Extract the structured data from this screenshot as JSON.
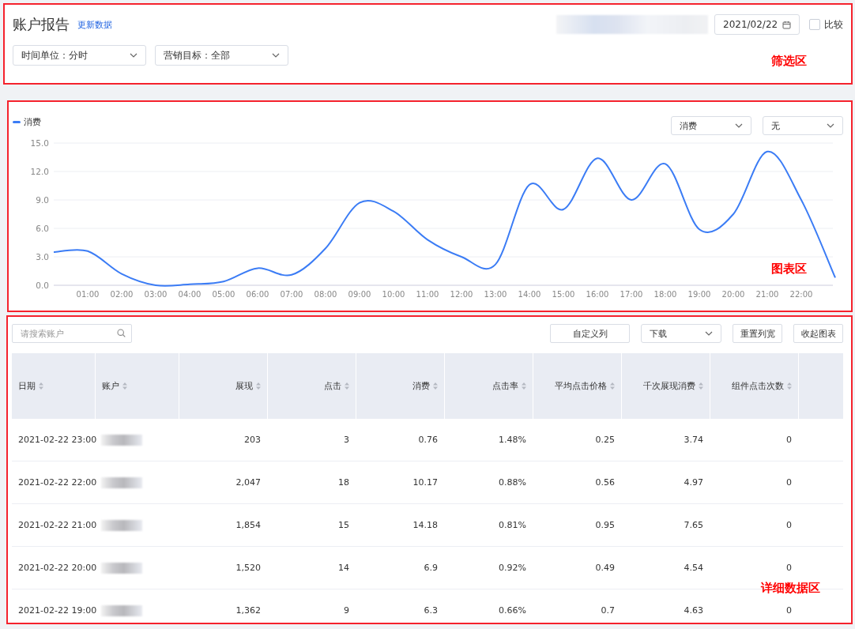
{
  "header": {
    "title": "账户报告",
    "refresh_link": "更新数据",
    "filters": [
      {
        "label": "时间单位：分时"
      },
      {
        "label": "营销目标：全部"
      }
    ],
    "date": "2021/02/22",
    "compare": {
      "label": "比较",
      "checked": false
    },
    "annotation": "筛选区"
  },
  "chart_panel": {
    "selects": [
      "消费",
      "无"
    ],
    "annotation": "图表区",
    "chart_data": {
      "type": "line",
      "grid": true,
      "x": [
        0,
        1,
        2,
        3,
        4,
        5,
        6,
        7,
        8,
        9,
        10,
        11,
        12,
        13,
        14,
        15,
        16,
        17,
        18,
        19,
        20,
        21,
        22,
        23
      ],
      "xlim": [
        0,
        23
      ],
      "xticks": [
        {
          "value": 1,
          "label": "01:00"
        },
        {
          "value": 2,
          "label": "02:00"
        },
        {
          "value": 3,
          "label": "03:00"
        },
        {
          "value": 4,
          "label": "04:00"
        },
        {
          "value": 5,
          "label": "05:00"
        },
        {
          "value": 6,
          "label": "06:00"
        },
        {
          "value": 7,
          "label": "07:00"
        },
        {
          "value": 8,
          "label": "08:00"
        },
        {
          "value": 9,
          "label": "09:00"
        },
        {
          "value": 10,
          "label": "10:00"
        },
        {
          "value": 11,
          "label": "11:00"
        },
        {
          "value": 12,
          "label": "12:00"
        },
        {
          "value": 13,
          "label": "13:00"
        },
        {
          "value": 14,
          "label": "14:00"
        },
        {
          "value": 15,
          "label": "15:00"
        },
        {
          "value": 16,
          "label": "16:00"
        },
        {
          "value": 17,
          "label": "17:00"
        },
        {
          "value": 18,
          "label": "18:00"
        },
        {
          "value": 19,
          "label": "19:00"
        },
        {
          "value": 20,
          "label": "20:00"
        },
        {
          "value": 21,
          "label": "21:00"
        },
        {
          "value": 22,
          "label": "22:00"
        }
      ],
      "ylim": [
        0,
        15
      ],
      "yticks": [
        {
          "value": 0,
          "label": "0.0"
        },
        {
          "value": 3,
          "label": "3.0"
        },
        {
          "value": 6,
          "label": "6.0"
        },
        {
          "value": 9,
          "label": "9.0"
        },
        {
          "value": 12,
          "label": "12.0"
        },
        {
          "value": 15,
          "label": "15.0"
        }
      ],
      "series": [
        {
          "name": "消费",
          "color": "#3b7cf5",
          "values": [
            3.5,
            3.6,
            1.2,
            0.0,
            0.1,
            0.4,
            1.8,
            1.1,
            3.9,
            8.7,
            7.8,
            4.8,
            3.0,
            2.2,
            10.6,
            8.0,
            13.4,
            9.0,
            12.8,
            5.9,
            7.5,
            14.1,
            9.0,
            0.8
          ]
        }
      ]
    }
  },
  "table_panel": {
    "search_placeholder": "请搜索账户",
    "buttons": [
      {
        "kind": "button",
        "label": "自定义列"
      },
      {
        "kind": "select",
        "label": "下载"
      },
      {
        "kind": "button",
        "label": "重置列宽"
      },
      {
        "kind": "button",
        "label": "收起图表"
      }
    ],
    "annotation": "详细数据区",
    "columns": [
      "日期",
      "账户",
      "展现",
      "点击",
      "消费",
      "点击率",
      "平均点击价格",
      "千次展现消费",
      "组件点击次数"
    ],
    "rows": [
      [
        "2021-02-22 23:00",
        "",
        "203",
        "3",
        "0.76",
        "1.48%",
        "0.25",
        "3.74",
        "0"
      ],
      [
        "2021-02-22 22:00",
        "",
        "2,047",
        "18",
        "10.17",
        "0.88%",
        "0.56",
        "4.97",
        "0"
      ],
      [
        "2021-02-22 21:00",
        "",
        "1,854",
        "15",
        "14.18",
        "0.81%",
        "0.95",
        "7.65",
        "0"
      ],
      [
        "2021-02-22 20:00",
        "",
        "1,520",
        "14",
        "6.9",
        "0.92%",
        "0.49",
        "4.54",
        "0"
      ],
      [
        "2021-02-22 19:00",
        "",
        "1,362",
        "9",
        "6.3",
        "0.66%",
        "0.7",
        "4.63",
        "0"
      ]
    ]
  }
}
